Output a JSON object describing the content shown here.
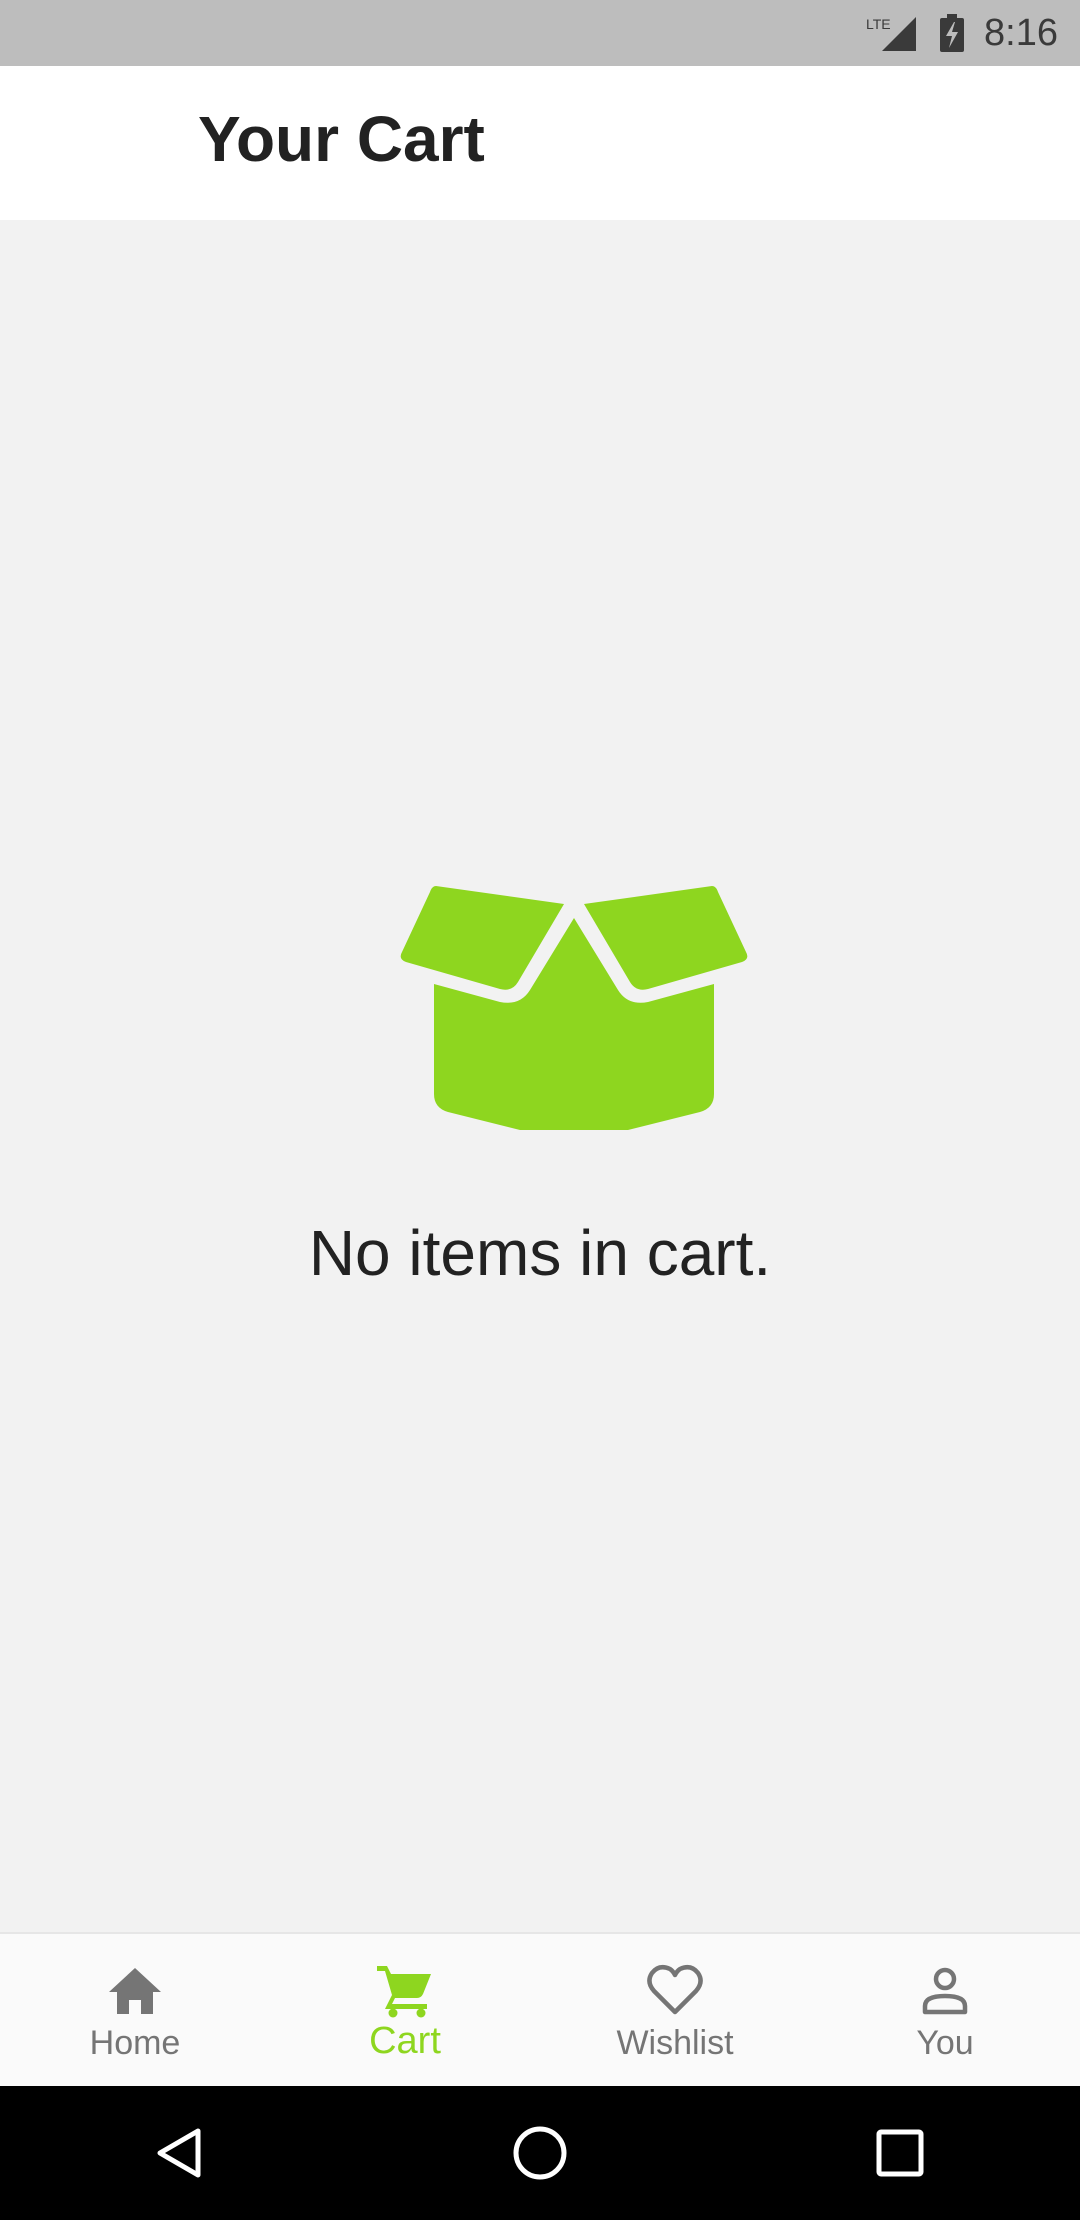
{
  "status_bar": {
    "network": "LTE",
    "time": "8:16"
  },
  "app_bar": {
    "title": "Your Cart"
  },
  "empty_state": {
    "icon": "open-box-icon",
    "message": "No items in cart."
  },
  "bottom_nav": {
    "items": [
      {
        "label": "Home",
        "icon": "home-icon"
      },
      {
        "label": "Cart",
        "icon": "cart-icon",
        "active": true
      },
      {
        "label": "Wishlist",
        "icon": "heart-icon"
      },
      {
        "label": "You",
        "icon": "person-icon"
      }
    ]
  },
  "colors": {
    "accent": "#8ed61f",
    "inactive": "#757575",
    "background": "#f2f2f2",
    "text": "#222222"
  }
}
